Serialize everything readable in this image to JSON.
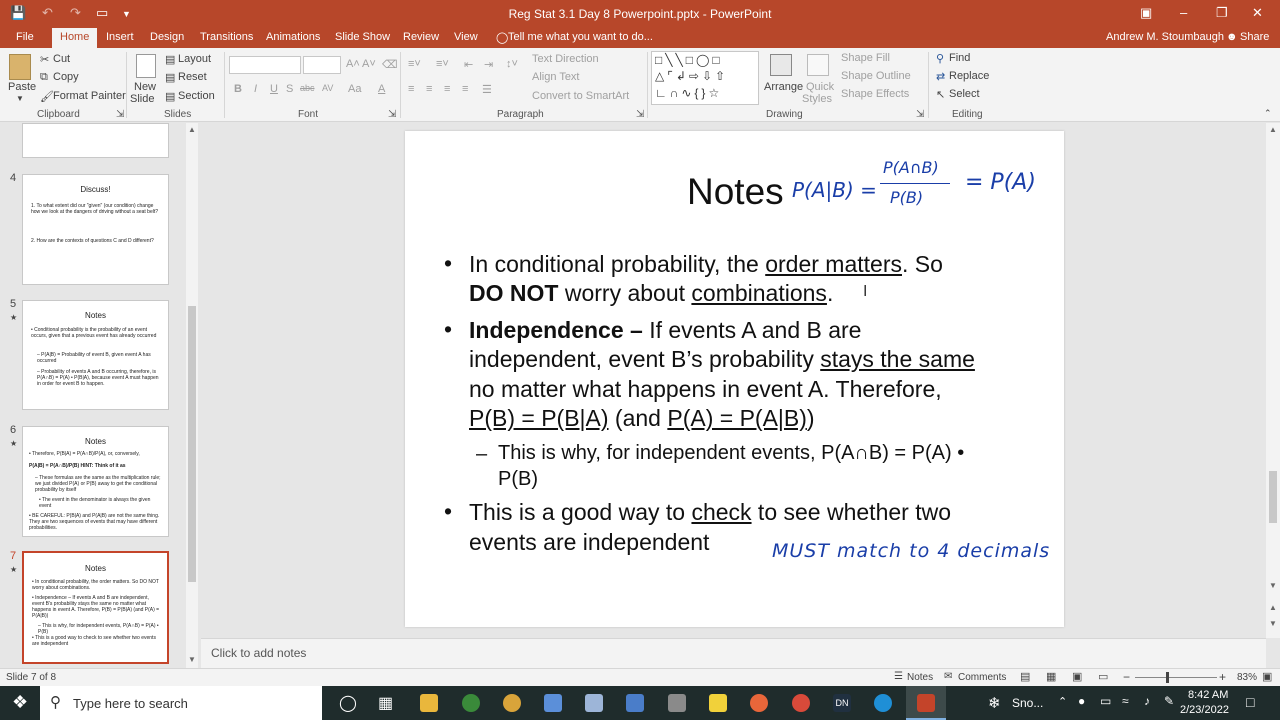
{
  "window": {
    "title": "Reg Stat 3.1 Day 8 Powerpoint.pptx - PowerPoint",
    "user": "Andrew M. Stoumbaugh",
    "share": "Share"
  },
  "tabs": [
    "File",
    "Home",
    "Insert",
    "Design",
    "Transitions",
    "Animations",
    "Slide Show",
    "Review",
    "View"
  ],
  "tell_me": "Tell me what you want to do...",
  "ribbon": {
    "clipboard": {
      "paste": "Paste",
      "cut": "Cut",
      "copy": "Copy",
      "format_painter": "Format Painter",
      "label": "Clipboard"
    },
    "slides": {
      "new_slide_1": "New",
      "new_slide_2": "Slide",
      "layout": "Layout",
      "reset": "Reset",
      "section": "Section",
      "label": "Slides"
    },
    "font": {
      "label": "Font",
      "bold": "B",
      "italic": "I",
      "underline": "U",
      "strike": "S",
      "shadow": "abc",
      "spacing": "AV",
      "case": "Aa",
      "color": "A"
    },
    "paragraph": {
      "text_direction": "Text Direction",
      "align_text": "Align Text",
      "convert": "Convert to SmartArt",
      "label": "Paragraph"
    },
    "drawing": {
      "arrange": "Arrange",
      "quick_1": "Quick",
      "quick_2": "Styles",
      "shape_fill": "Shape Fill",
      "shape_outline": "Shape Outline",
      "shape_effects": "Shape Effects",
      "label": "Drawing"
    },
    "editing": {
      "find": "Find",
      "replace": "Replace",
      "select": "Select",
      "label": "Editing"
    }
  },
  "thumbnails": [
    {
      "num": "4",
      "title": "Discuss!",
      "lines": [
        "1. To what extent did our \"given\" (our condition) change how we look at the dangers of driving without a seat belt?",
        "",
        "2. How are the contexts of questions C and D different?"
      ]
    },
    {
      "num": "5",
      "star": "★",
      "title": "Notes",
      "lines": [
        "• Conditional probability is the probability of an event occurs, given that a previous event has already occurred",
        "– P(A|B) = Probability of event B, given event A has occurred",
        "– Probability of events A and B occurring, therefore, is P(A∩B) = P(A) • P(B|A), because event A must happen in order for event B to happen."
      ]
    },
    {
      "num": "6",
      "star": "★",
      "title": "Notes",
      "lines": [
        "• Therefore, P(B|A) = P(A∩B)/P(A), or, conversely,",
        "P(A|B) = P(A∩B)/P(B) HINT: Think of it as",
        "– These formulas are the same as the multiplication rule; we just divided P(A) or P(B) away to get the conditional probability by itself",
        "• The event in the denominator is always the given event",
        "• BE CAREFUL: P(B|A) and P(A|B) are not the same thing. They are two sequences of events that may have different probabilities."
      ]
    },
    {
      "num": "7",
      "star": "★",
      "title": "Notes",
      "lines": [
        "• In conditional probability, the order matters. So DO NOT worry about combinations.",
        "• Independence – If events A and B are independent, event B's probability stays the same no matter what happens in event A. Therefore, P(B) = P(B|A) (and P(A) = P(A|B))",
        "– This is why, for independent events, P(A∩B) = P(A) • P(B)",
        "• This is a good way to check to see whether two events are independent"
      ]
    }
  ],
  "slide": {
    "title": "Notes",
    "ink_formula_left": "P(A|B) =",
    "ink_formula_num": "P(A∩B)",
    "ink_formula_den": "P(B)",
    "ink_formula_right": "= P(A)",
    "ink_note": "MUST match to 4 decimals",
    "b1_a": "In conditional probability, the ",
    "b1_u": "order matters",
    "b1_b": ". So",
    "b1_bold": "DO NOT",
    "b1_c": " worry about ",
    "b1_u2": "combinations",
    "b1_d": ".",
    "b2_bold": "Independence –",
    "b2_a": " If events A and B are",
    "b2_b": "independent, event B’s probability ",
    "b2_u": "stays the same",
    "b2_c": "no matter what happens in event A. Therefore,",
    "b2_u2": "P(B) = P(B|A)",
    "b2_d": " (and ",
    "b2_u3": "P(A) = P(A|B)",
    "b2_e": ")",
    "sub_dash": "–",
    "sub_a": "This is why, for independent events, P(A∩B) = P(A) •",
    "sub_b": "P(B)",
    "b3_a": "This is a good way to ",
    "b3_u": "check",
    "b3_b": " to see whether two",
    "b3_c": "events are independent",
    "bullet": "•"
  },
  "notes_placeholder": "Click to add notes",
  "status": {
    "slide_count": "Slide 7 of 8",
    "notes": "Notes",
    "comments": "Comments",
    "zoom": "83%"
  },
  "taskbar": {
    "search": "Type here to search",
    "weather": "Sno...",
    "time": "8:42 AM",
    "date": "2/23/2022"
  },
  "colors": {
    "accent": "#b7472a",
    "ink": "#1a3ea8",
    "taskbar": "#1f2c2c"
  }
}
